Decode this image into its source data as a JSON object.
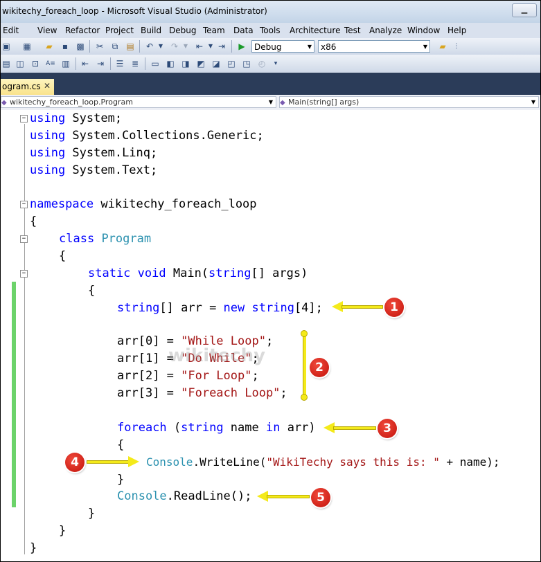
{
  "window": {
    "title": "wikitechy_foreach_loop - Microsoft Visual Studio (Administrator)",
    "minimize_glyph": "▁"
  },
  "menu": [
    "Edit",
    "View",
    "Refactor",
    "Project",
    "Build",
    "Debug",
    "Team",
    "Data",
    "Tools",
    "Architecture",
    "Test",
    "Analyze",
    "Window",
    "Help"
  ],
  "toolbar": {
    "configuration": "Debug",
    "platform": "x86"
  },
  "tab": {
    "label": "ogram.cs",
    "close_glyph": "✕"
  },
  "navigation": {
    "class_selector": "wikitechy_foreach_loop.Program",
    "member_selector": "Main(string[] args)"
  },
  "code": {
    "l1_kw": "using",
    "l1_rest": " System;",
    "l2_kw": "using",
    "l2_rest": " System.Collections.Generic;",
    "l3_kw": "using",
    "l3_rest": " System.Linq;",
    "l4_kw": "using",
    "l4_rest": " System.Text;",
    "l6_kw": "namespace",
    "l6_rest": " wikitechy_foreach_loop",
    "brace_open": "{",
    "brace_close": "}",
    "l8_kw": "class",
    "l8_type": "Program",
    "l10_kw1": "static",
    "l10_kw2": "void",
    "l10_mid": " Main(",
    "l10_kw3": "string",
    "l10_rest": "[] args)",
    "l12_kw1": "string",
    "l12_mid": "[] arr = ",
    "l12_kw2": "new",
    "l12_kw3": "string",
    "l12_rest": "[4];",
    "l14_pre": "arr[0] = ",
    "l14_str": "\"While Loop\"",
    "l14_end": ";",
    "l15_pre": "arr[1] = ",
    "l15_str": "\"Do While\"",
    "l15_end": ";",
    "l16_pre": "arr[2] = ",
    "l16_str": "\"For Loop\"",
    "l16_end": ";",
    "l17_pre": "arr[3] = ",
    "l17_str": "\"Foreach Loop\"",
    "l17_end": ";",
    "l19_kw1": "foreach",
    "l19_mid1": " (",
    "l19_kw2": "string",
    "l19_mid2": " name ",
    "l19_kw3": "in",
    "l19_rest": " arr)",
    "l21_type": "Console",
    "l21_mid": ".WriteLine(",
    "l21_str": "\"WikiTechy says this is: \"",
    "l21_rest": " + name);",
    "l23_type": "Console",
    "l23_rest": ".ReadLine();"
  },
  "annotations": [
    "1",
    "2",
    "3",
    "4",
    "5"
  ],
  "watermark": "wikitechy",
  "colors": {
    "keyword": "#0000ff",
    "type": "#2b91af",
    "string": "#a31515",
    "badge": "#d9231a",
    "arrow": "#f4ea1a",
    "change_margin": "#6cd36a",
    "tab_strip": "#2b3c59"
  }
}
